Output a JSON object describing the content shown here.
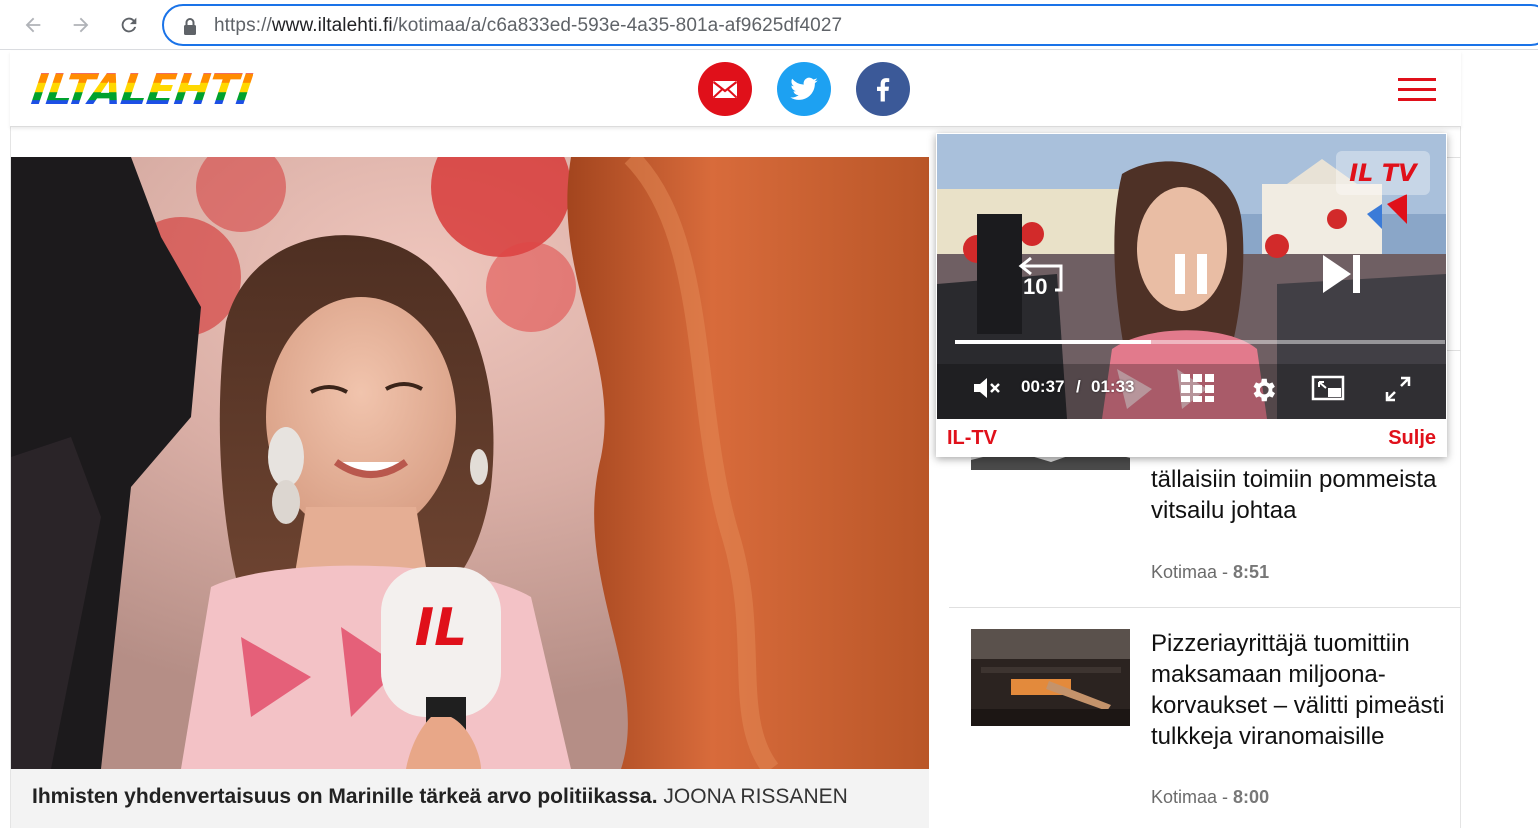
{
  "browser": {
    "url_prefix": "https://",
    "url_host": "www.iltalehti.fi",
    "url_path": "/kotimaa/a/c6a833ed-593e-4a35-801a-af9625df4027"
  },
  "site": {
    "logo_text": "ILTALEHTI",
    "share": [
      "mail-icon",
      "twitter-icon",
      "facebook-icon"
    ]
  },
  "article": {
    "caption_text": "Ihmisten yhdenvertaisuus on Marinille tärkeä arvo politiikassa.",
    "caption_credit": "JOONA RISSANEN",
    "mic_logo": "IL"
  },
  "video": {
    "badge": "IL TV",
    "rewind_seconds": "10",
    "current_time": "00:37",
    "separator": "/",
    "duration": "01:33",
    "progress": 0.4,
    "label": "IL-TV",
    "close_label": "Sulje"
  },
  "sidebar": {
    "items": [
      {
        "title": "tällaisiin toimiin pommeista vitsailu johtaa",
        "category": "Kotimaa",
        "sep": " - ",
        "time": "8:51"
      },
      {
        "title": "Pizzeriayrittäjä tuomittiin maksamaan miljoona-korvaukset – välitti pimeästi tulkkeja viranomaisille",
        "category": "Kotimaa",
        "sep": " - ",
        "time": "8:00"
      }
    ]
  },
  "colors": {
    "brand_red": "#e0101a",
    "twitter_blue": "#1da1f2",
    "facebook_blue": "#3b5998",
    "address_focus": "#1a73e8"
  }
}
